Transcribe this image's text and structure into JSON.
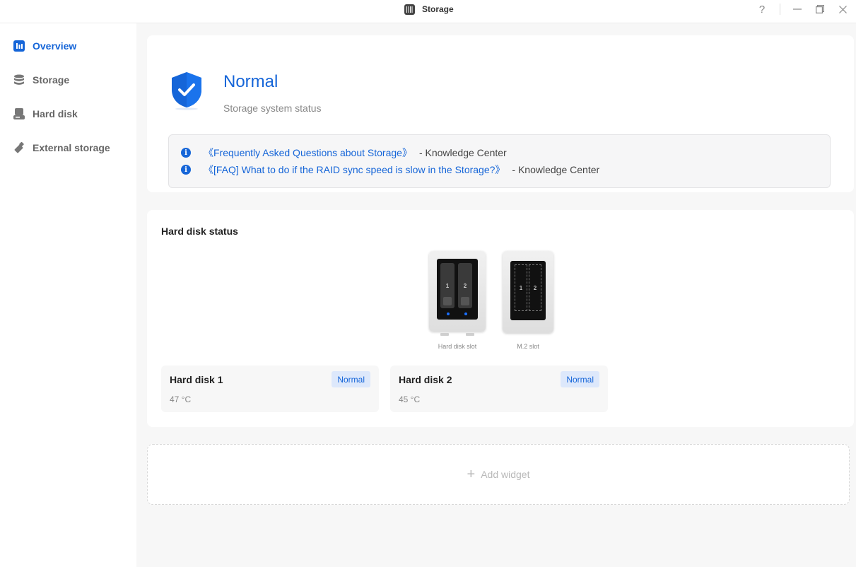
{
  "window": {
    "title": "Storage",
    "app_icon": "storage-app-icon",
    "controls": {
      "help": "?",
      "minimize": "—",
      "restore": "❐",
      "close": "✕"
    }
  },
  "sidebar": {
    "items": [
      {
        "label": "Overview",
        "icon": "overview-icon",
        "active": true
      },
      {
        "label": "Storage",
        "icon": "database-icon",
        "active": false
      },
      {
        "label": "Hard disk",
        "icon": "hard-disk-icon",
        "active": false
      },
      {
        "label": "External storage",
        "icon": "usb-drive-icon",
        "active": false
      }
    ]
  },
  "status": {
    "title": "Normal",
    "subtitle": "Storage system status",
    "icon": "shield-check-icon",
    "knowledge": [
      {
        "link": "《Frequently Asked Questions about Storage》",
        "suffix": "- Knowledge Center"
      },
      {
        "link": "《[FAQ] What to do if the RAID sync speed is slow in the Storage?》",
        "suffix": "- Knowledge Center"
      }
    ]
  },
  "hard_disk_status": {
    "title": "Hard disk status",
    "devices": [
      {
        "caption": "Hard disk slot",
        "slots": [
          "1",
          "2"
        ]
      },
      {
        "caption": "M.2 slot",
        "slots": [
          "1",
          "2"
        ]
      }
    ],
    "disks": [
      {
        "name": "Hard disk 1",
        "temp": "47 °C",
        "status": "Normal"
      },
      {
        "name": "Hard disk 2",
        "temp": "45 °C",
        "status": "Normal"
      }
    ]
  },
  "add_widget": {
    "label": "Add widget",
    "icon": "plus-icon"
  },
  "colors": {
    "accent": "#1565d8",
    "badge_bg": "#dde8fb",
    "page_bg": "#f7f7f7"
  }
}
